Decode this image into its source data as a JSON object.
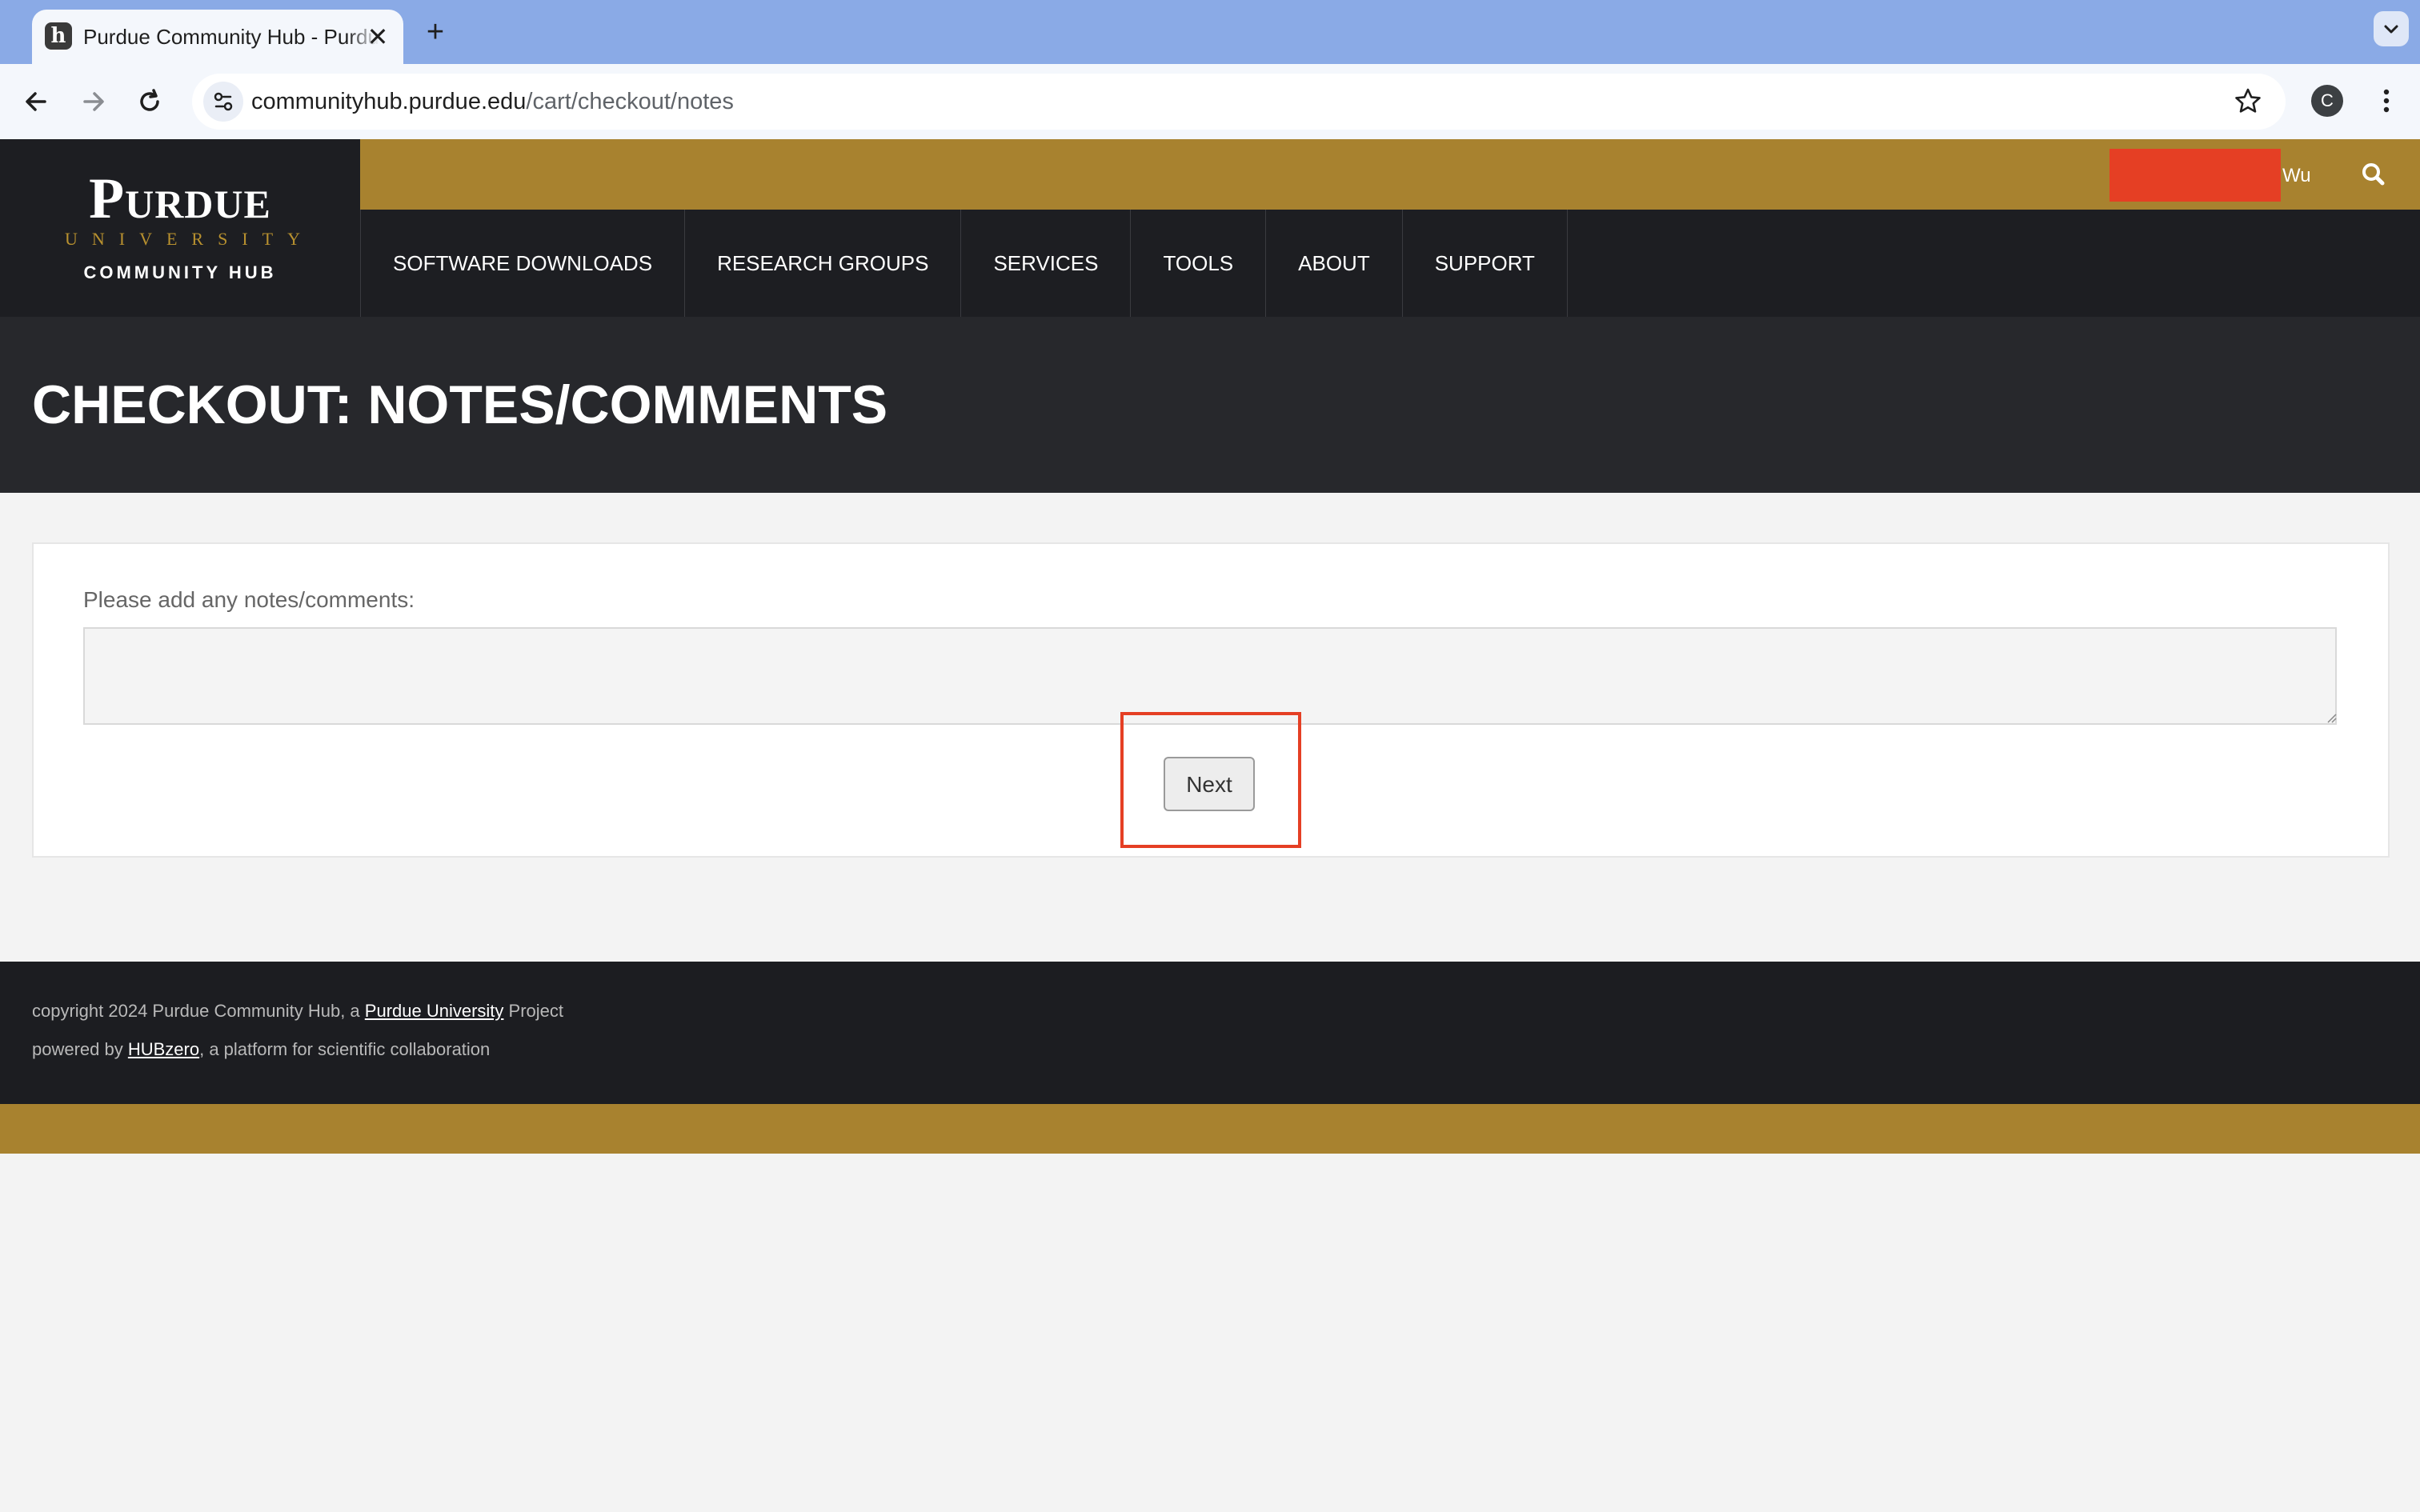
{
  "browser": {
    "tab_title": "Purdue Community Hub - Purdue University",
    "tab_favicon": "h",
    "url_host": "communityhub.purdue.edu",
    "url_path": "/cart/checkout/notes",
    "profile_initial": "C"
  },
  "site": {
    "logo_name": "Purdue",
    "logo_sub": "UNIVERSITY",
    "logo_hub": "COMMUNITY HUB",
    "user_name": "Wu",
    "redaction_color": "#e53f24",
    "accent_gold": "#a8822f",
    "nav": [
      {
        "label": "SOFTWARE DOWNLOADS"
      },
      {
        "label": "RESEARCH GROUPS"
      },
      {
        "label": "SERVICES"
      },
      {
        "label": "TOOLS"
      },
      {
        "label": "ABOUT"
      },
      {
        "label": "SUPPORT"
      }
    ]
  },
  "page": {
    "title": "CHECKOUT: NOTES/COMMENTS",
    "notes_label": "Please add any notes/comments:",
    "notes_value": "",
    "next_label": "Next",
    "highlight_color": "#e53f24"
  },
  "footer": {
    "line1_prefix": "copyright 2024 Purdue Community Hub, a ",
    "line1_link": "Purdue University",
    "line1_suffix": " Project",
    "line2_prefix": "powered by ",
    "line2_link": "HUBzero",
    "line2_suffix": ", a platform for scientific collaboration"
  },
  "icons": [
    "favicon-icon",
    "close-icon",
    "plus-icon",
    "chevron-down-icon",
    "back-icon",
    "forward-icon",
    "reload-icon",
    "site-settings-icon",
    "star-icon",
    "more-vert-icon",
    "search-icon"
  ]
}
